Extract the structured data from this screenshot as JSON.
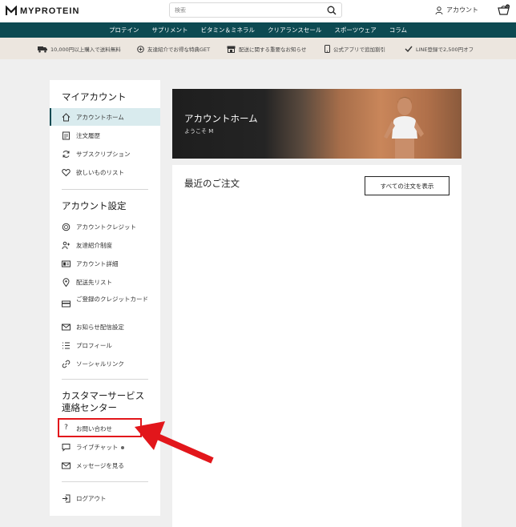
{
  "header": {
    "logo_text": "MYPROTEIN",
    "search_placeholder": "検索",
    "account_label": "アカウント",
    "cart_count": "0"
  },
  "nav": {
    "items": [
      "プロテイン",
      "サプリメント",
      "ビタミン＆ミネラル",
      "クリアランスセール",
      "スポーツウェア",
      "コラム"
    ]
  },
  "promo": {
    "items": [
      {
        "icon": "truck-icon",
        "label": "10,000円以上購入で送料無料"
      },
      {
        "icon": "referral-icon",
        "label": "友達紹介でお得な特典GET"
      },
      {
        "icon": "warehouse-icon",
        "label": "配送に関する重要なお知らせ"
      },
      {
        "icon": "phone-icon",
        "label": "公式アプリで追加割引"
      },
      {
        "icon": "check-icon",
        "label": "LINE登録で2,500円オフ"
      }
    ]
  },
  "sidebar": {
    "my_account_title": "マイアカウント",
    "my_account_items": [
      {
        "icon": "home-icon",
        "label": "アカウントホーム",
        "active": true
      },
      {
        "icon": "receipt-icon",
        "label": "注文履歴"
      },
      {
        "icon": "refresh-icon",
        "label": "サブスクリプション"
      },
      {
        "icon": "heart-icon",
        "label": "欲しいものリスト"
      }
    ],
    "settings_title": "アカウント設定",
    "settings_items": [
      {
        "icon": "credit-coin-icon",
        "label": "アカウントクレジット"
      },
      {
        "icon": "referral-icon",
        "label": "友達紹介制度"
      },
      {
        "icon": "id-card-icon",
        "label": "アカウント詳細"
      },
      {
        "icon": "location-pin-icon",
        "label": "配送先リスト"
      },
      {
        "icon": "credit-card-icon",
        "label": "ご登録のクレジットカード"
      },
      {
        "icon": "mail-icon",
        "label": "お知らせ配信設定"
      },
      {
        "icon": "list-icon",
        "label": "プロフィール"
      },
      {
        "icon": "link-icon",
        "label": "ソーシャルリンク"
      }
    ],
    "support_title_line1": "カスタマーサービス",
    "support_title_line2": "連絡センター",
    "support_items": [
      {
        "icon": "question-icon",
        "label": "お問い合わせ"
      },
      {
        "icon": "chat-icon",
        "label": "ライブチャット"
      },
      {
        "icon": "mail-icon",
        "label": "メッセージを見る"
      }
    ],
    "logout_label": "ログアウト"
  },
  "hero": {
    "title": "アカウントホーム",
    "subtitle": "ようこそ M"
  },
  "orders": {
    "title": "最近のご注文",
    "view_all_label": "すべての注文を表示"
  },
  "colors": {
    "nav_bg": "#0d4a52",
    "promo_bg": "#ece6df",
    "active_bg": "#d9ebee",
    "annotation_red": "#e2161b"
  }
}
